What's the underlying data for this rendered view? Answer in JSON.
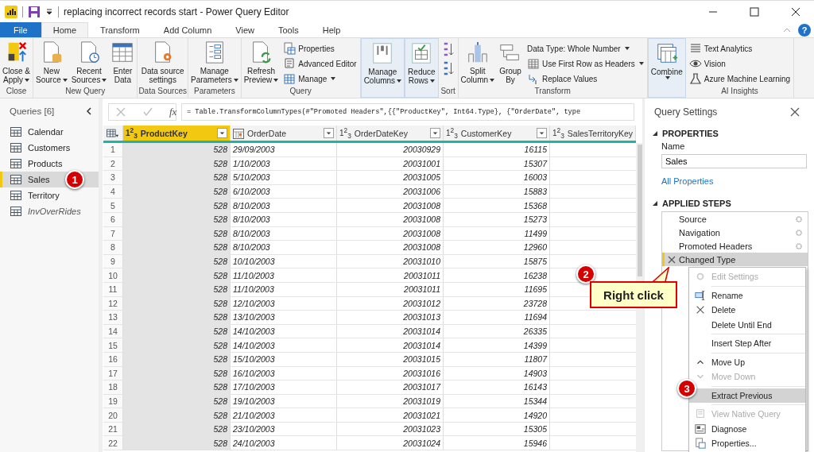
{
  "window": {
    "title": "replacing incorrect records start - Power Query Editor"
  },
  "tabs": [
    {
      "label": "File",
      "kind": "file",
      "selected": false
    },
    {
      "label": "Home",
      "kind": "tab",
      "selected": true
    },
    {
      "label": "Transform",
      "kind": "tab",
      "selected": false
    },
    {
      "label": "Add Column",
      "kind": "tab",
      "selected": false
    },
    {
      "label": "View",
      "kind": "tab",
      "selected": false
    },
    {
      "label": "Tools",
      "kind": "tab",
      "selected": false
    },
    {
      "label": "Help",
      "kind": "tab",
      "selected": false
    }
  ],
  "help": "?",
  "ribbon": [
    {
      "label": "Close",
      "highlighted": false,
      "items": [
        {
          "kind": "large",
          "lines": [
            "Close &",
            "Apply"
          ],
          "dropdown": true
        }
      ]
    },
    {
      "label": "New Query",
      "highlighted": false,
      "items": [
        {
          "kind": "large",
          "lines": [
            "New",
            "Source"
          ],
          "dropdown": true
        },
        {
          "kind": "large",
          "lines": [
            "Recent",
            "Sources"
          ],
          "dropdown": true
        },
        {
          "kind": "large",
          "lines": [
            "Enter",
            "Data"
          ],
          "dropdown": false
        }
      ]
    },
    {
      "label": "Data Sources",
      "highlighted": false,
      "items": [
        {
          "kind": "large",
          "lines": [
            "Data source",
            "settings"
          ],
          "dropdown": false
        }
      ]
    },
    {
      "label": "Parameters",
      "highlighted": false,
      "items": [
        {
          "kind": "large",
          "lines": [
            "Manage",
            "Parameters"
          ],
          "dropdown": true
        }
      ]
    },
    {
      "label": "Query",
      "highlighted": false,
      "items": [
        {
          "kind": "large",
          "lines": [
            "Refresh",
            "Preview"
          ],
          "dropdown": true
        },
        {
          "kind": "stack",
          "entries": [
            {
              "label": "Properties",
              "dropdown": false
            },
            {
              "label": "Advanced Editor",
              "dropdown": false
            },
            {
              "label": "Manage",
              "dropdown": true
            }
          ]
        }
      ]
    },
    {
      "highlighted": true,
      "items": [
        {
          "kind": "large",
          "lines": [
            "Manage",
            "Columns"
          ],
          "dropdown": true
        }
      ]
    },
    {
      "highlighted": true,
      "items": [
        {
          "kind": "large",
          "lines": [
            "Reduce",
            "Rows"
          ],
          "dropdown": true
        }
      ]
    },
    {
      "label": "Sort",
      "highlighted": false,
      "items": [
        {
          "kind": "sort"
        }
      ]
    },
    {
      "label": "Transform",
      "highlighted": false,
      "items": [
        {
          "kind": "large",
          "lines": [
            "Split",
            "Column"
          ],
          "dropdown": true
        },
        {
          "kind": "large",
          "lines": [
            "Group",
            "By"
          ],
          "dropdown": false
        },
        {
          "kind": "stack",
          "entries": [
            {
              "label": "Data Type: Whole Number",
              "dropdown": true
            },
            {
              "label": "Use First Row as Headers",
              "dropdown": true
            },
            {
              "label": "Replace Values",
              "dropdown": false
            }
          ]
        }
      ]
    },
    {
      "highlighted": true,
      "items": [
        {
          "kind": "large",
          "lines": [
            "Combine"
          ],
          "dropdown": true
        }
      ]
    },
    {
      "label": "AI Insights",
      "highlighted": false,
      "items": [
        {
          "kind": "stack",
          "entries": [
            {
              "label": "Text Analytics",
              "dropdown": false
            },
            {
              "label": "Vision",
              "dropdown": false
            },
            {
              "label": "Azure Machine Learning",
              "dropdown": false
            }
          ]
        }
      ]
    }
  ],
  "queries": {
    "title": "Queries [6]",
    "items": [
      {
        "name": "Calendar",
        "selected": false,
        "load_disabled": false
      },
      {
        "name": "Customers",
        "selected": false,
        "load_disabled": false
      },
      {
        "name": "Products",
        "selected": false,
        "load_disabled": false
      },
      {
        "name": "Sales",
        "selected": true,
        "load_disabled": false
      },
      {
        "name": "Territory",
        "selected": false,
        "load_disabled": false
      },
      {
        "name": "InvOverRides",
        "selected": false,
        "load_disabled": true
      }
    ]
  },
  "formula_bar": {
    "fx": "fx",
    "formula": "= Table.TransformColumnTypes(#\"Promoted Headers\",{{\"ProductKey\", Int64.Type}, {\"OrderDate\", type"
  },
  "table": {
    "columns": [
      {
        "kind": "index"
      },
      {
        "name": "ProductKey",
        "kind": "number",
        "type_label": "1$^{2}$$_{3}$",
        "selected": true,
        "filter": true
      },
      {
        "name": "OrderDate",
        "kind": "date",
        "selected": false,
        "filter": true
      },
      {
        "name": "OrderDateKey",
        "kind": "number",
        "type_label": "1$^{2}$$_{3}$",
        "selected": false,
        "filter": true
      },
      {
        "name": "CustomerKey",
        "kind": "number",
        "type_label": "1$^{2}$$_{3}$",
        "selected": false,
        "filter": true
      },
      {
        "name": "SalesTerritoryKey",
        "kind": "number",
        "type_label": "1$^{2}$$_{3}$",
        "selected": false,
        "filter": false
      }
    ],
    "rows": [
      [
        "1",
        "528",
        "29/09/2003",
        "20030929",
        "16115"
      ],
      [
        "2",
        "528",
        "1/10/2003",
        "20031001",
        "15307"
      ],
      [
        "3",
        "528",
        "5/10/2003",
        "20031005",
        "16003"
      ],
      [
        "4",
        "528",
        "6/10/2003",
        "20031006",
        "15883"
      ],
      [
        "5",
        "528",
        "8/10/2003",
        "20031008",
        "15368"
      ],
      [
        "6",
        "528",
        "8/10/2003",
        "20031008",
        "15273"
      ],
      [
        "7",
        "528",
        "8/10/2003",
        "20031008",
        "11499"
      ],
      [
        "8",
        "528",
        "8/10/2003",
        "20031008",
        "12960"
      ],
      [
        "9",
        "528",
        "10/10/2003",
        "20031010",
        "15875"
      ],
      [
        "10",
        "528",
        "11/10/2003",
        "20031011",
        "16238"
      ],
      [
        "11",
        "528",
        "11/10/2003",
        "20031011",
        "11695"
      ],
      [
        "12",
        "528",
        "12/10/2003",
        "20031012",
        "23728"
      ],
      [
        "13",
        "528",
        "13/10/2003",
        "20031013",
        "11694"
      ],
      [
        "14",
        "528",
        "14/10/2003",
        "20031014",
        "26335"
      ],
      [
        "15",
        "528",
        "14/10/2003",
        "20031014",
        "14399"
      ],
      [
        "16",
        "528",
        "15/10/2003",
        "20031015",
        "11807"
      ],
      [
        "17",
        "528",
        "16/10/2003",
        "20031016",
        "14903"
      ],
      [
        "18",
        "528",
        "17/10/2003",
        "20031017",
        "16143"
      ],
      [
        "19",
        "528",
        "19/10/2003",
        "20031019",
        "15344"
      ],
      [
        "20",
        "528",
        "21/10/2003",
        "20031021",
        "14920"
      ],
      [
        "21",
        "528",
        "23/10/2003",
        "20031023",
        "15305"
      ],
      [
        "22",
        "528",
        "24/10/2003",
        "20031024",
        "15946"
      ]
    ]
  },
  "settings": {
    "title": "Query Settings",
    "properties_heading": "PROPERTIES",
    "name_label": "Name",
    "name_value": "Sales",
    "all_properties": "All Properties",
    "steps_heading": "APPLIED STEPS",
    "steps": [
      {
        "name": "Source",
        "has_settings": true,
        "selected": false
      },
      {
        "name": "Navigation",
        "has_settings": true,
        "selected": false
      },
      {
        "name": "Promoted Headers",
        "has_settings": true,
        "selected": false
      },
      {
        "name": "Changed Type",
        "has_settings": false,
        "selected": true
      }
    ]
  },
  "context_menu": [
    {
      "kind": "item",
      "label": "Edit Settings",
      "disabled": true,
      "selected": false
    },
    {
      "kind": "separator"
    },
    {
      "kind": "item",
      "label": "Rename",
      "disabled": false,
      "selected": false
    },
    {
      "kind": "item",
      "label": "Delete",
      "disabled": false,
      "selected": false
    },
    {
      "kind": "item",
      "label": "Delete Until End",
      "disabled": false,
      "selected": false
    },
    {
      "kind": "separator"
    },
    {
      "kind": "item",
      "label": "Insert Step After",
      "disabled": false,
      "selected": false
    },
    {
      "kind": "separator"
    },
    {
      "kind": "item",
      "label": "Move Up",
      "disabled": false,
      "selected": false
    },
    {
      "kind": "item",
      "label": "Move Down",
      "disabled": true,
      "selected": false
    },
    {
      "kind": "separator"
    },
    {
      "kind": "item",
      "label": "Extract Previous",
      "disabled": false,
      "selected": true
    },
    {
      "kind": "separator"
    },
    {
      "kind": "item",
      "label": "View Native Query",
      "disabled": true,
      "selected": false
    },
    {
      "kind": "item",
      "label": "Diagnose",
      "disabled": false,
      "selected": false
    },
    {
      "kind": "item",
      "label": "Properties...",
      "disabled": false,
      "selected": false
    }
  ],
  "annotations": {
    "badges": [
      "1",
      "2",
      "3"
    ],
    "callout": "Right click"
  }
}
